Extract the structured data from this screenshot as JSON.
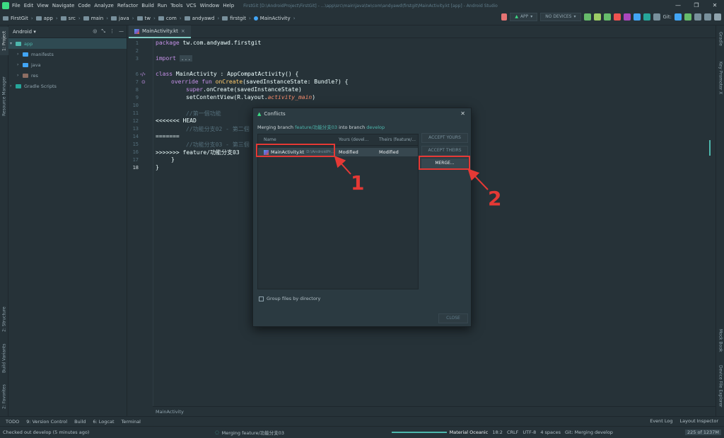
{
  "menubar": {
    "items": [
      "File",
      "Edit",
      "View",
      "Navigate",
      "Code",
      "Analyze",
      "Refactor",
      "Build",
      "Run",
      "Tools",
      "VCS",
      "Window",
      "Help"
    ],
    "window_title": "FirstGit [D:\\AndroidProject\\FirstGit] - ...\\app\\src\\main\\java\\tw\\com\\andyawd\\firstgit\\MainActivity.kt [app] - Android Studio",
    "window_controls": [
      "—",
      "❐",
      "✕"
    ]
  },
  "navbar": {
    "crumbs": [
      "FirstGit",
      "app",
      "src",
      "main",
      "java",
      "tw",
      "com",
      "andyawd",
      "firstgit",
      "MainActivity"
    ],
    "run_config": "APP",
    "device": "NO DEVICES",
    "git_label": "Git:"
  },
  "left_strip": {
    "tabs": [
      "1: Project",
      "Resource Manager",
      "2: Structure",
      "Build Variants",
      "2: Favorites"
    ]
  },
  "right_strip": {
    "tabs": [
      "Gradle",
      "Key Promoter X",
      "Mock Book",
      "Device File Explorer"
    ]
  },
  "project": {
    "view": "Android",
    "tree": [
      {
        "label": "app",
        "level": 0,
        "selected": true
      },
      {
        "label": "manifests",
        "level": 1
      },
      {
        "label": "java",
        "level": 1
      },
      {
        "label": "res",
        "level": 1
      },
      {
        "label": "Gradle Scripts",
        "level": 0
      }
    ]
  },
  "editor": {
    "tab": "MainActivity.kt",
    "line_numbers": [
      "1",
      "2",
      "3",
      "6",
      "7",
      "8",
      "9",
      "10",
      "11",
      "12",
      "13",
      "14",
      "15",
      "16",
      "17",
      "18"
    ],
    "breadcrumb": "MainActivity"
  },
  "code": {
    "l1_kw": "package",
    "l1_rest": " tw.com.andyawd.firstgit",
    "l2_kw": "import",
    "l2_fold": "...",
    "l3_kw": "class",
    "l3_rest": " MainActivity : AppCompatActivity() {",
    "l4_kw": "override fun",
    "l4_fn": "onCreate",
    "l4_rest": "(savedInstanceState: Bundle?) {",
    "l5_kw": "super",
    "l5_rest": ".onCreate(savedInstanceState)",
    "l6_pre": "setContentView(R.layout.",
    "l6_it": "activity_main",
    "l6_post": ")",
    "l7_cm": "//第一個功能",
    "l8": "<<<<<<< HEAD",
    "l9_cm": "//功能分支02 - 第二個",
    "l10": "=======",
    "l11_cm": "//功能分支03 - 第三個",
    "l12": ">>>>>>> feature/功能分支03",
    "l13": "}",
    "l14": "}"
  },
  "dialog": {
    "title": "Conflicts",
    "close_glyph": "✕",
    "msg_pre": "Merging branch ",
    "msg_branch": "feature/功能分支03",
    "msg_mid": " into branch ",
    "msg_target": "develop",
    "columns": [
      "Name",
      "Yours (devel...",
      "Theirs (feature/..."
    ],
    "row": {
      "name": "MainActivity.kt",
      "path": "D:\\AndroidPr...",
      "yours": "Modified",
      "theirs": "Modified"
    },
    "buttons": {
      "accept_yours": "ACCEPT YOURS",
      "accept_theirs": "ACCEPT THEIRS",
      "merge": "MERGE...",
      "close": "CLOSE"
    },
    "group_label": "Group files by directory"
  },
  "annotations": {
    "n1": "1",
    "n2": "2"
  },
  "toolwindows": {
    "left": [
      "TODO",
      "9: Version Control",
      "Build",
      "6: Logcat",
      "Terminal"
    ],
    "right": [
      "Event Log",
      "Layout Inspector"
    ]
  },
  "status": {
    "left": "Checked out develop (5 minutes ago)",
    "progress": "Merging feature/功能分支03",
    "theme": "Material Oceanic",
    "pos": "18:2",
    "eol": "CRLF",
    "enc": "UTF-8",
    "indent": "4 spaces",
    "git": "Git: Merging develop",
    "memory": "225 of 1237M"
  },
  "colors": {
    "accent": "#80cbc4",
    "annotation": "#e53935",
    "android": "#3ddc84"
  }
}
